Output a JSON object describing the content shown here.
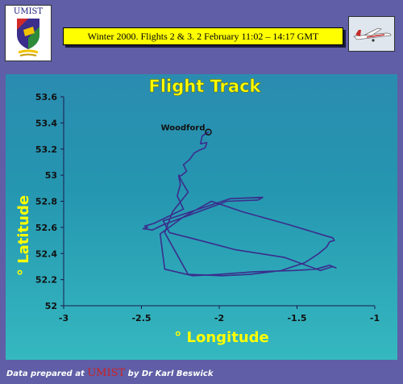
{
  "header": {
    "logo_text": "UMIST",
    "title": "Winter 2000.   Flights 2 & 3.   2 February  11:02 – 14:17 GMT"
  },
  "footer": {
    "prefix": "Data prepared at",
    "brand": "UMIST",
    "suffix": "by Dr Karl Beswick"
  },
  "colors": {
    "track": "#3a2d8c",
    "title": "#ffff00",
    "axis_label": "#ffff00",
    "background": "#5f5ea6"
  },
  "chart_data": {
    "type": "line",
    "title": "Flight Track",
    "xlabel": "° Longitude",
    "ylabel": "° Latitude",
    "xlim": [
      -3,
      -1
    ],
    "ylim": [
      52,
      53.6
    ],
    "xticks": [
      "-3",
      "-2.5",
      "-2",
      "-1.5",
      "-1"
    ],
    "yticks": [
      "52",
      "52.2",
      "52.4",
      "52.6",
      "52.8",
      "53",
      "53.2",
      "53.4",
      "53.6"
    ],
    "grid": false,
    "annotation": {
      "label": "Woodford",
      "x": -2.07,
      "y": 53.33
    },
    "series": [
      {
        "x": [
          -2.07,
          -2.11,
          -2.12,
          -2.08,
          -2.09,
          -2.13,
          -2.16,
          -2.19,
          -2.23,
          -2.21,
          -2.24,
          -2.26,
          -2.25,
          -2.27,
          -2.23,
          -2.42,
          -2.48,
          -2.46,
          -2.49,
          -2.43,
          -2.36,
          -1.95,
          -1.75,
          -1.72,
          -1.93,
          -2.36,
          -2.32,
          -2.09,
          -1.9,
          -1.58,
          -1.35,
          -1.27,
          -1.25,
          -1.29,
          -1.38,
          -1.52,
          -1.78,
          -2.0,
          -2.17,
          -2.35,
          -2.38,
          -2.23,
          -2.05,
          -1.85,
          -1.55,
          -1.3,
          -1.27,
          -1.26,
          -1.29,
          -1.31,
          -1.36,
          -1.45,
          -1.6,
          -1.8,
          -1.98,
          -2.2,
          -2.35,
          -2.3,
          -2.2,
          -2.24,
          -2.26
        ],
        "y": [
          53.33,
          53.3,
          53.24,
          53.25,
          53.21,
          53.19,
          53.17,
          53.12,
          53.08,
          53.03,
          53.0,
          52.99,
          52.93,
          52.84,
          52.74,
          52.63,
          52.61,
          52.6,
          52.59,
          52.58,
          52.62,
          52.8,
          52.81,
          52.83,
          52.82,
          52.65,
          52.56,
          52.49,
          52.43,
          52.37,
          52.27,
          52.3,
          52.29,
          52.31,
          52.28,
          52.27,
          52.26,
          52.24,
          52.23,
          52.28,
          52.55,
          52.68,
          52.8,
          52.72,
          52.62,
          52.53,
          52.52,
          52.5,
          52.49,
          52.45,
          52.4,
          52.33,
          52.27,
          52.24,
          52.23,
          52.24,
          52.56,
          52.72,
          52.87,
          52.95,
          53.0
        ]
      }
    ]
  }
}
